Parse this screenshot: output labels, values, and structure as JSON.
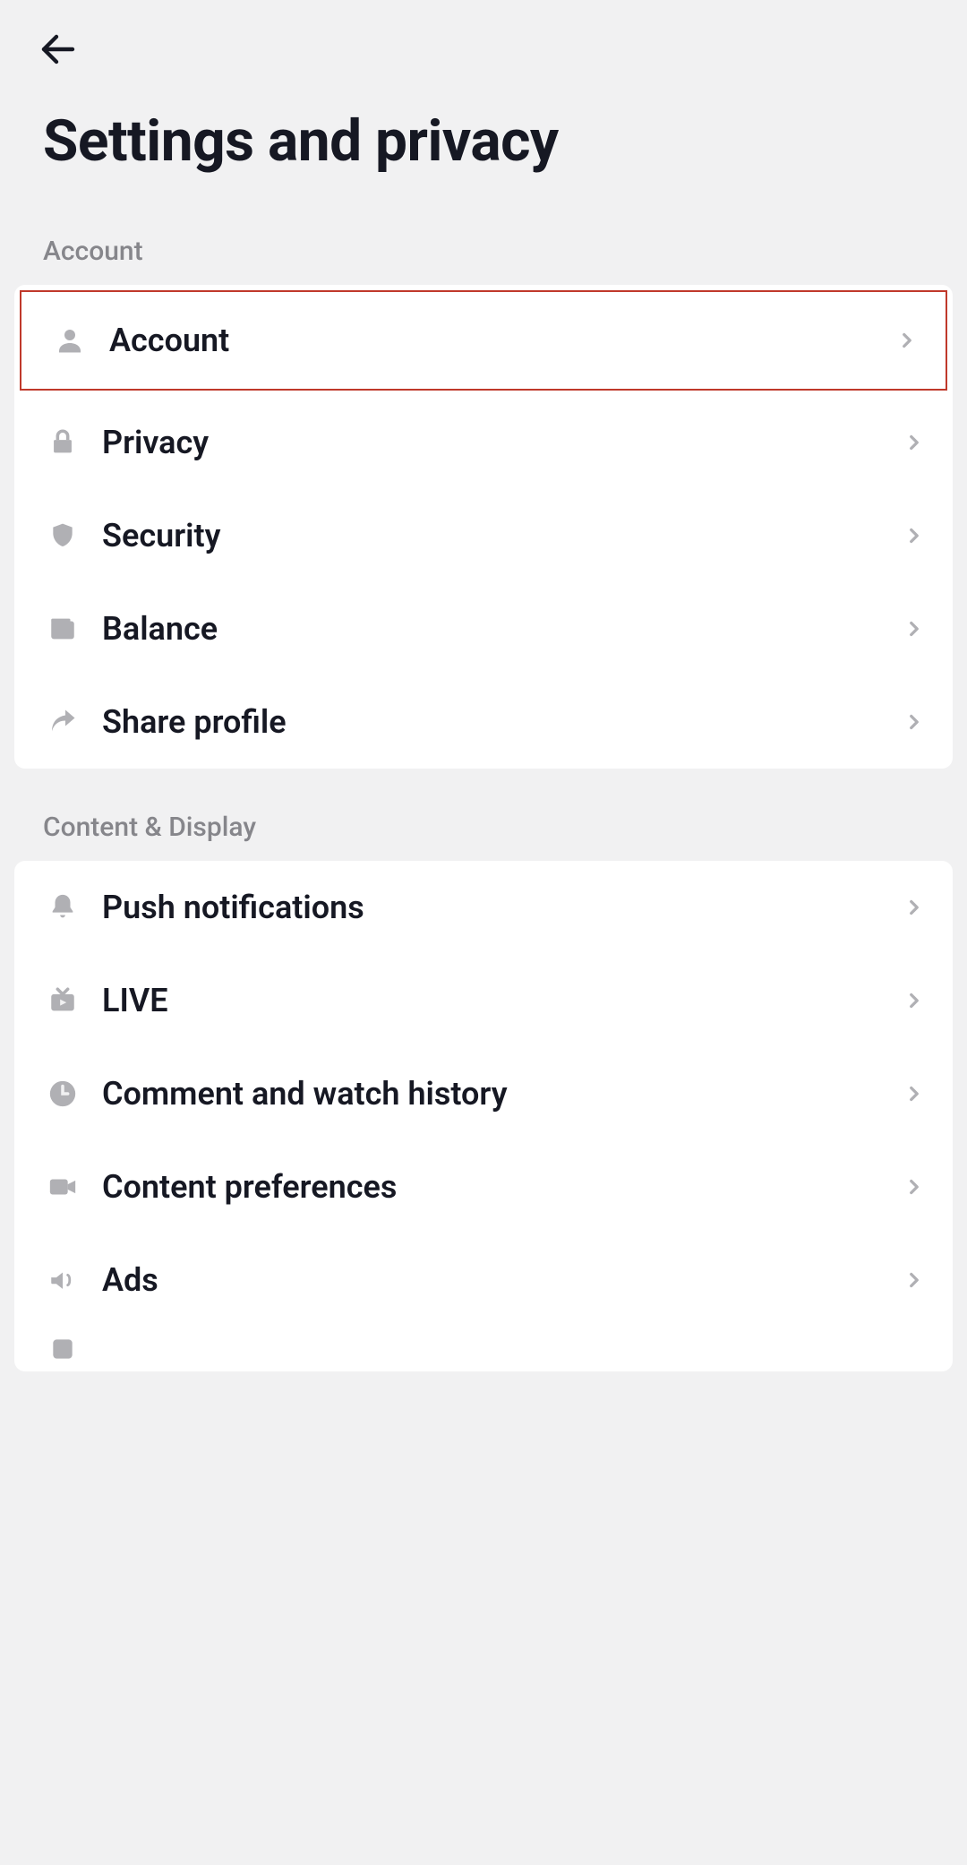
{
  "header": {
    "title": "Settings and privacy"
  },
  "sections": {
    "account": {
      "header": "Account",
      "items": [
        {
          "label": "Account"
        },
        {
          "label": "Privacy"
        },
        {
          "label": "Security"
        },
        {
          "label": "Balance"
        },
        {
          "label": "Share profile"
        }
      ]
    },
    "content_display": {
      "header": "Content & Display",
      "items": [
        {
          "label": "Push notifications"
        },
        {
          "label": "LIVE"
        },
        {
          "label": "Comment and watch history"
        },
        {
          "label": "Content preferences"
        },
        {
          "label": "Ads"
        }
      ]
    }
  }
}
